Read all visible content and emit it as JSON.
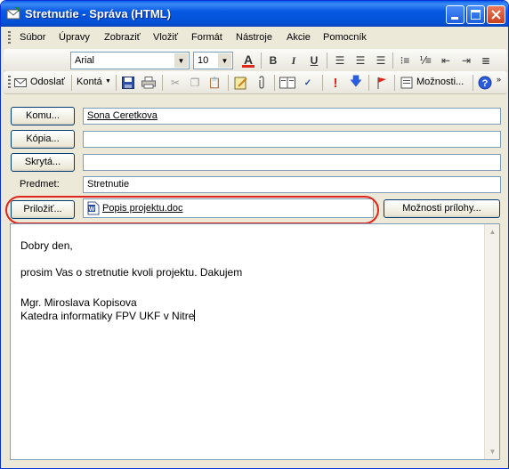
{
  "window": {
    "title": "Stretnutie - Správa (HTML)"
  },
  "menu": [
    "Súbor",
    "Úpravy",
    "Zobraziť",
    "Vložiť",
    "Formát",
    "Nástroje",
    "Akcie",
    "Pomocník"
  ],
  "format_toolbar": {
    "font": "Arial",
    "size": "10"
  },
  "standard_toolbar": {
    "send": "Odoslať",
    "accounts": "Kontá",
    "options": "Možnosti..."
  },
  "fields": {
    "to_button": "Komu...",
    "to_value": "Sona Ceretkova",
    "cc_button": "Kópia...",
    "cc_value": "",
    "bcc_button": "Skrytá...",
    "bcc_value": "",
    "subject_label": "Predmet:",
    "subject_value": "Stretnutie",
    "attach_button": "Priložiť...",
    "attachment_name": "Popis projektu.doc",
    "attachment_options_button": "Možnosti prílohy..."
  },
  "body": {
    "greeting": "Dobry den,",
    "text": "prosim Vas o stretnutie kvoli projektu. Dakujem",
    "signature_name": "Mgr. Miroslava Kopisova",
    "signature_dept": "Katedra informatiky FPV UKF v Nitre"
  },
  "colors": {
    "titlebar": "#0351d6",
    "highlight": "#e0251b",
    "link": "#0000cc"
  }
}
